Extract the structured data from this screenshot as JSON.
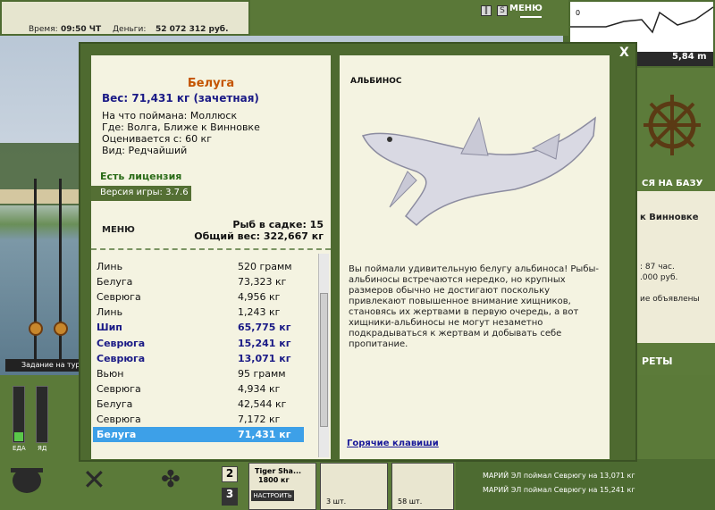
{
  "topbar": {
    "time_label": "Время:",
    "time_value": "09:50 ЧТ",
    "money_label": "Деньги:",
    "money_value": "52 072 312 руб."
  },
  "top_menu_label": "МЕНЮ",
  "depth": {
    "value": "5,84 m",
    "origin_label": "0"
  },
  "task_label": "Задание на тур",
  "right_panel": {
    "base_label": "СЯ НА БАЗУ",
    "location": "к Винновке",
    "info_lines": [
      ": 87 час.",
      ".000 руб.",
      "",
      "ие объявлены"
    ],
    "secrets_label": "РЕТЫ"
  },
  "bottom": {
    "food_label": "ЕДА",
    "poison_label": "ЯД",
    "slot2": "2",
    "slot3": "3",
    "lure_name": "Tiger Sha...",
    "lure_weight": "1800 кг",
    "setup_button": "НАСТРОИТЬ",
    "qty1": "3 шт.",
    "qty2": "58 шт."
  },
  "log": [
    "МАРИЙ ЭЛ поймал Севрюгу на 13,071 кг",
    "МАРИЙ ЭЛ поймал Севрюгу на 15,241 кг"
  ],
  "dialog": {
    "close_label": "X",
    "fish_name": "Белуга",
    "fish_weight": "Вес: 71,431 кг (зачетная)",
    "caught_with": "На что поймана: Моллюск",
    "location": "Где: Волга, Ближе к Винновке",
    "rated_from": "Оценивается с: 60 кг",
    "kind": "Вид: Редчайший",
    "license": "Есть лицензия",
    "version_label": "Версия игры:",
    "version_value": "3.7.6",
    "menu_label": "МЕНЮ",
    "cage_count": "Рыб в садке: 15",
    "cage_total": "Общий вес: 322,667 кг",
    "albino_title": "АЛЬБИНОС",
    "description": "Вы поймали удивительную белугу альбиноса! Рыбы-альбиносы встречаются нередко, но крупных размеров обычно не достигают поскольку привлекают повышенное внимание хищников, становясь их жертвами в первую очередь, а вот хищники-альбиносы не могут незаметно подкрадываться к жертвам и добывать себе пропитание.",
    "hotkeys_label": "Горячие клавиши",
    "catches": [
      {
        "name": "Линь",
        "weight": "520 грамм",
        "bold": false,
        "selected": false
      },
      {
        "name": "Белуга",
        "weight": "73,323 кг",
        "bold": false,
        "selected": false
      },
      {
        "name": "Севрюга",
        "weight": "4,956 кг",
        "bold": false,
        "selected": false
      },
      {
        "name": "Линь",
        "weight": "1,243 кг",
        "bold": false,
        "selected": false
      },
      {
        "name": "Шип",
        "weight": "65,775 кг",
        "bold": true,
        "selected": false
      },
      {
        "name": "Севрюга",
        "weight": "15,241 кг",
        "bold": true,
        "selected": false
      },
      {
        "name": "Севрюга",
        "weight": "13,071 кг",
        "bold": true,
        "selected": false
      },
      {
        "name": "Вьюн",
        "weight": "95 грамм",
        "bold": false,
        "selected": false
      },
      {
        "name": "Севрюга",
        "weight": "4,934 кг",
        "bold": false,
        "selected": false
      },
      {
        "name": "Белуга",
        "weight": "42,544 кг",
        "bold": false,
        "selected": false
      },
      {
        "name": "Севрюга",
        "weight": "7,172 кг",
        "bold": false,
        "selected": false
      },
      {
        "name": "Белуга",
        "weight": "71,431 кг",
        "bold": false,
        "selected": true
      }
    ]
  }
}
